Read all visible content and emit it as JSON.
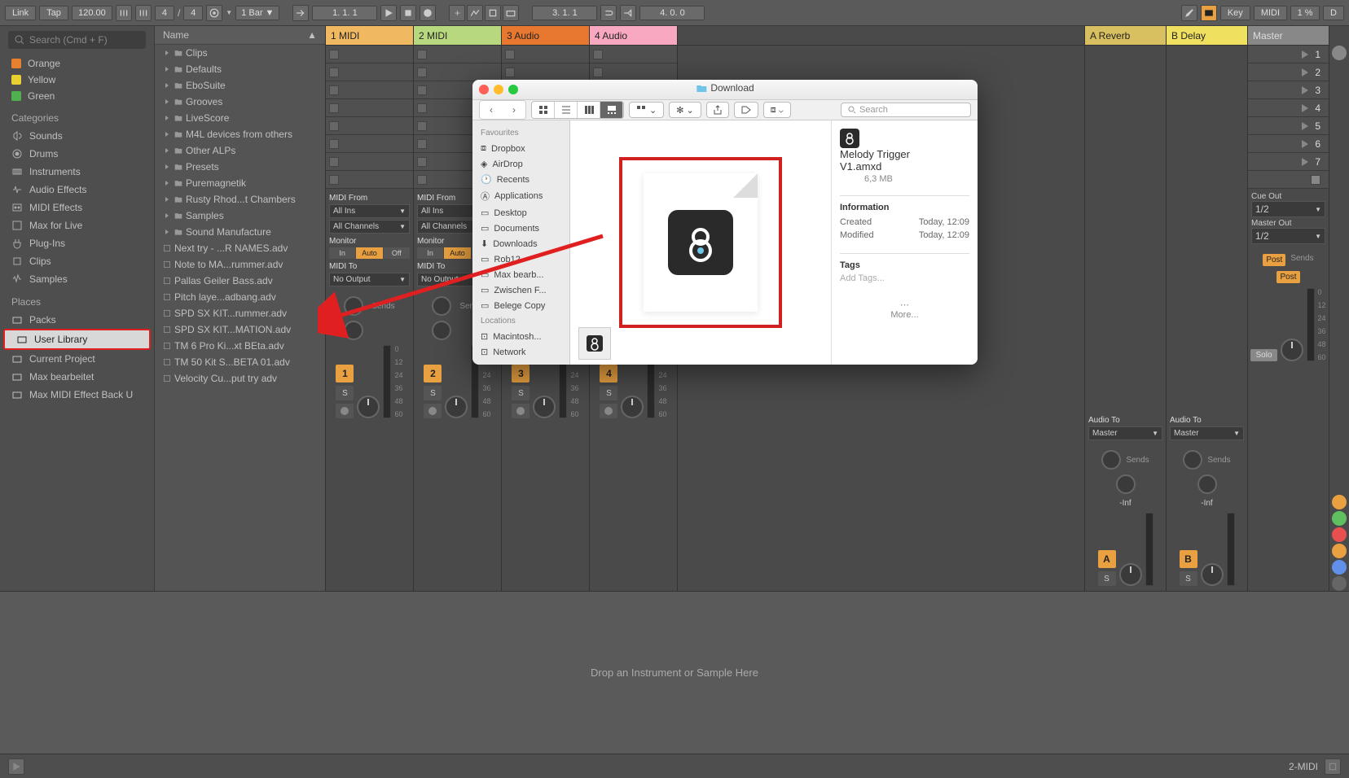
{
  "toolbar": {
    "link": "Link",
    "tap": "Tap",
    "tempo": "120.00",
    "sig_num": "4",
    "sig_den": "4",
    "quantize": "1 Bar",
    "position": "1.  1.  1",
    "arr_pos": "3.  1.  1",
    "loop_len": "4.  0.  0",
    "key": "Key",
    "midi": "MIDI",
    "cpu": "1 %",
    "d": "D"
  },
  "browser": {
    "search_placeholder": "Search (Cmd + F)",
    "tags": [
      {
        "label": "Orange",
        "color": "#e88030"
      },
      {
        "label": "Yellow",
        "color": "#e8d030"
      },
      {
        "label": "Green",
        "color": "#50b050"
      }
    ],
    "categories_hdr": "Categories",
    "categories": [
      "Sounds",
      "Drums",
      "Instruments",
      "Audio Effects",
      "MIDI Effects",
      "Max for Live",
      "Plug-Ins",
      "Clips",
      "Samples"
    ],
    "places_hdr": "Places",
    "places": [
      "Packs",
      "User Library",
      "Current Project",
      "Max bearbeitet",
      "Max MIDI Effect Back U"
    ],
    "name_hdr": "Name",
    "folders": [
      "Clips",
      "Defaults",
      "EboSuite",
      "Grooves",
      "LiveScore",
      "M4L devices from others",
      "Other ALPs",
      "Presets",
      "Puremagnetik",
      "Rusty Rhod...t Chambers",
      "Samples",
      "Sound Manufacture"
    ],
    "files": [
      "Next try - ...R NAMES.adv",
      "Note to MA...rummer.adv",
      "Pallas  Geiler Bass.adv",
      "Pitch laye...adbang.adv",
      "SPD SX KIT...rummer.adv",
      "SPD SX KIT...MATION.adv",
      "TM 6 Pro Ki...xt BEta.adv",
      "TM 50 Kit S...BETA 01.adv",
      "Velocity Cu...put try adv"
    ]
  },
  "tracks": [
    {
      "name": "1 MIDI",
      "num": "1",
      "hdr": "hdr-1"
    },
    {
      "name": "2 MIDI",
      "num": "2",
      "hdr": "hdr-2"
    },
    {
      "name": "3 Audio",
      "num": "3",
      "hdr": "hdr-3"
    },
    {
      "name": "4 Audio",
      "num": "4",
      "hdr": "hdr-4"
    }
  ],
  "returns": [
    {
      "name": "A Reverb",
      "num": "A",
      "hdr": "hdr-a"
    },
    {
      "name": "B Delay",
      "num": "B",
      "hdr": "hdr-b"
    }
  ],
  "master": {
    "name": "Master",
    "scenes": [
      "1",
      "2",
      "3",
      "4",
      "5",
      "6",
      "7"
    ]
  },
  "io": {
    "midi_from": "MIDI From",
    "all_ins": "All Ins",
    "all_channels": "All Channels",
    "monitor": "Monitor",
    "in": "In",
    "auto": "Auto",
    "off": "Off",
    "midi_to": "MIDI To",
    "no_output": "No Output",
    "audio_to": "Audio To",
    "master": "Master",
    "sends": "Sends",
    "post": "Post",
    "cue_out": "Cue Out",
    "cue_12": "1/2",
    "master_out": "Master Out",
    "solo": "Solo",
    "inf": "-Inf",
    "s": "S"
  },
  "db_marks": [
    "0",
    "12",
    "24",
    "36",
    "48",
    "60"
  ],
  "detail": {
    "drop_text": "Drop an Instrument or Sample Here"
  },
  "status": {
    "right": "2-MIDI"
  },
  "finder": {
    "title": "Download",
    "sidebar": {
      "favourites": "Favourites",
      "fav_items": [
        "Dropbox",
        "AirDrop",
        "Recents",
        "Applications",
        "Desktop",
        "Documents",
        "Downloads",
        "Rob12",
        "Max bearb...",
        "Zwischen F...",
        "Belege Copy"
      ],
      "locations": "Locations",
      "loc_items": [
        "Macintosh...",
        "Network"
      ]
    },
    "search": "Search",
    "file": {
      "name": "Melody Trigger V1.amxd",
      "size": "6,3 MB"
    },
    "info": {
      "hdr": "Information",
      "created_k": "Created",
      "created_v": "Today, 12:09",
      "modified_k": "Modified",
      "modified_v": "Today, 12:09",
      "tags": "Tags",
      "add_tags": "Add Tags...",
      "more": "More..."
    }
  }
}
